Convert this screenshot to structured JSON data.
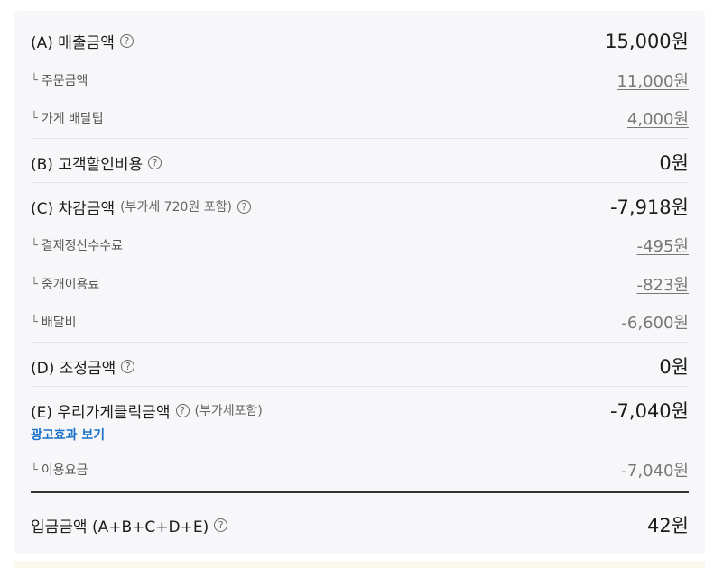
{
  "sections": {
    "a": {
      "label": "(A) 매출금액",
      "value": "15,000원",
      "subs": [
        {
          "label": "주문금액",
          "value": "11,000원"
        },
        {
          "label": "가게 배달팁",
          "value": "4,000원"
        }
      ]
    },
    "b": {
      "label": "(B) 고객할인비용",
      "value": "0원"
    },
    "c": {
      "label": "(C) 차감금액",
      "note": "(부가세 720원 포함)",
      "value": "-7,918원",
      "subs": [
        {
          "label": "결제정산수수료",
          "value": "-495원"
        },
        {
          "label": "중개이용료",
          "value": "-823원"
        },
        {
          "label": "배달비",
          "value": "-6,600원"
        }
      ]
    },
    "d": {
      "label": "(D) 조정금액",
      "value": "0원"
    },
    "e": {
      "label": "(E) 우리가게클릭금액",
      "note": "(부가세포함)",
      "value": "-7,040원",
      "ad_link": "광고효과 보기",
      "subs": [
        {
          "label": "이용요금",
          "value": "-7,040원"
        }
      ]
    },
    "total": {
      "label": "입금금액 (A+B+C+D+E)",
      "value": "42원"
    }
  },
  "icons": {
    "help": "help-circle-icon",
    "corner": "corner-bullet-icon"
  }
}
